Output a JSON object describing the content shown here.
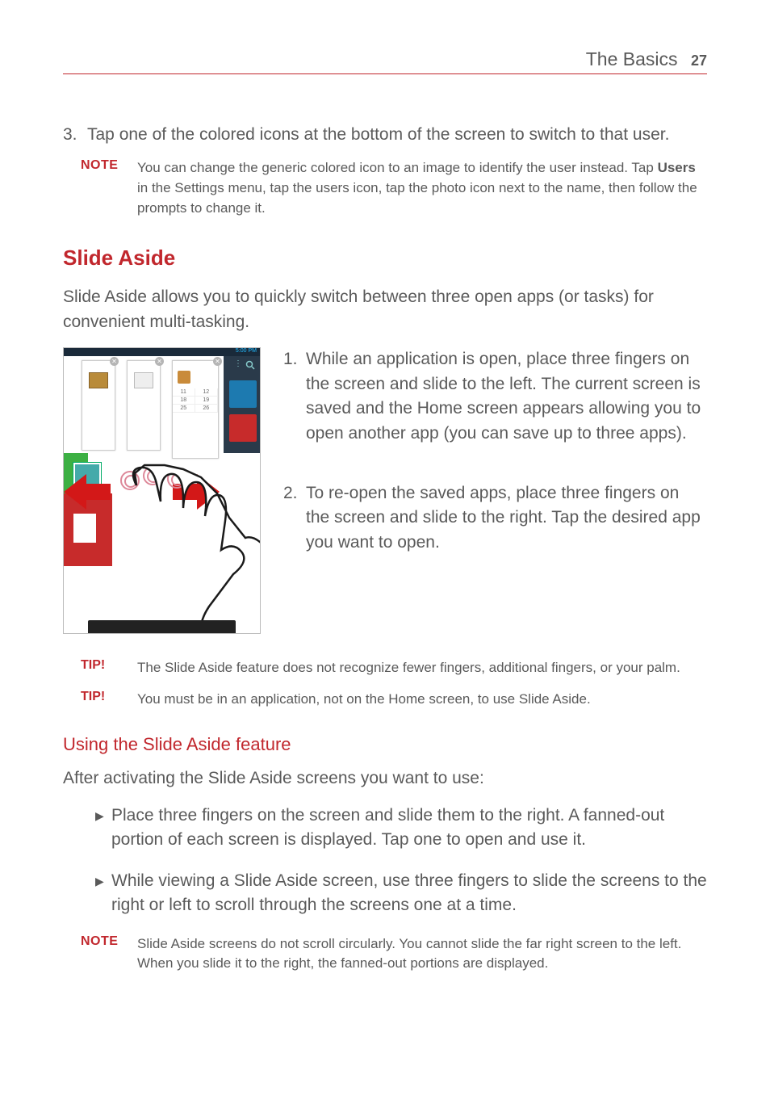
{
  "header": {
    "title": "The Basics",
    "page": "27"
  },
  "step3": {
    "num": "3.",
    "text": "Tap one of the colored icons at the bottom of the screen to switch to that user."
  },
  "note1": {
    "label": "NOTE",
    "pre": "You can change the generic colored icon to an image to identify the user instead. Tap ",
    "bold": "Users",
    "post": " in the Settings menu, tap the users icon, tap the photo icon next to the name, then follow the prompts to change it."
  },
  "h2": "Slide Aside",
  "intro": {
    "bold": "Slide Aside",
    "rest": " allows you to quickly switch between three open apps (or tasks) for convenient multi-tasking."
  },
  "olsteps": [
    {
      "num": "1.",
      "text": "While an application is open, place three fingers on the screen and slide to the left. The current screen is saved and the Home screen appears allowing you to open another app (you can save up to three apps)."
    },
    {
      "num": "2.",
      "text": "To re-open the saved apps, place three fingers on the screen and slide to the right. Tap the desired app you want to open."
    }
  ],
  "tips": [
    {
      "label": "TIP!",
      "text": "The Slide Aside feature does not recognize fewer fingers, additional fingers, or your palm."
    },
    {
      "label": "TIP!",
      "text": "You must be in an application, not on the Home screen, to use Slide Aside."
    }
  ],
  "h3": "Using the Slide Aside feature",
  "afterActivating": "After activating the Slide Aside screens you want to use:",
  "bullets": [
    "Place three fingers on the screen and slide them to the right. A fanned-out portion of each screen is displayed. Tap one to open and use it.",
    "While viewing a Slide Aside screen, use three fingers to slide the screens to the right or left to scroll through the screens one at a time."
  ],
  "note2": {
    "label": "NOTE",
    "text": "Slide Aside screens do not scroll circularly. You cannot slide the far right screen to the left. When you slide it to the right, the fanned-out portions are displayed."
  },
  "figure": {
    "statusTime": "5:00 PM",
    "cal": [
      "11",
      "12",
      "18",
      "19",
      "25",
      "26"
    ]
  }
}
